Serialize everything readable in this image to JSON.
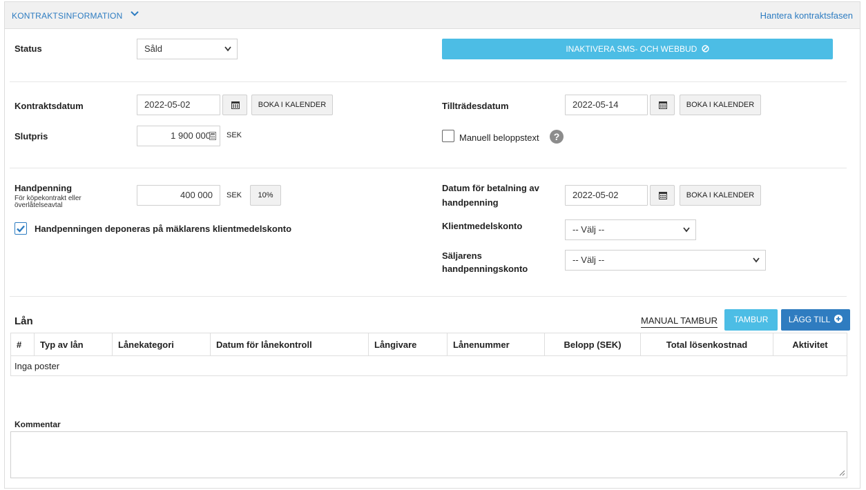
{
  "header": {
    "title": "KONTRAKTSINFORMATION",
    "link": "Hantera kontraktsfasen"
  },
  "status": {
    "label": "Status",
    "value": "Såld",
    "button": "INAKTIVERA SMS- OCH WEBBUD"
  },
  "contract": {
    "date_label": "Kontraktsdatum",
    "date_value": "2022-05-02",
    "calendar_button": "BOKA I KALENDER",
    "access_label": "Tillträdesdatum",
    "access_value": "2022-05-14",
    "price_label": "Slutpris",
    "price_value": "1 900 000",
    "currency": "SEK",
    "manual_label": "Manuell beloppstext"
  },
  "deposit": {
    "label": "Handpenning",
    "sublabel": "För köpekontrakt eller överlåtelseavtal",
    "value": "400 000",
    "currency": "SEK",
    "percent_button": "10%",
    "checkbox_label": "Handpenningen deponeras på mäklarens klientmedelskonto",
    "payment_label_1": "Datum för betalning av",
    "payment_label_2": "handpenning",
    "payment_value": "2022-05-02",
    "client_account_label": "Klientmedelskonto",
    "client_account_value": "-- Välj --",
    "seller_account_label_1": "Säljarens",
    "seller_account_label_2": "handpenningskonto",
    "seller_account_value": "-- Välj --"
  },
  "loans": {
    "title": "Lån",
    "manual_link": "MANUAL TAMBUR",
    "tambur_button": "TAMBUR",
    "add_button": "LÄGG TILL",
    "columns": [
      "#",
      "Typ av lån",
      "Lånekategori",
      "Datum för lånekontroll",
      "Långivare",
      "Lånenummer",
      "Belopp (SEK)",
      "Total lösenkostnad",
      "Aktivitet"
    ],
    "empty_text": "Inga poster"
  },
  "comment": {
    "label": "Kommentar"
  },
  "colors": {
    "accent_blue": "#2d7cc1",
    "cyan_button": "#4cbde5",
    "blue_button": "#2f7cc0"
  }
}
